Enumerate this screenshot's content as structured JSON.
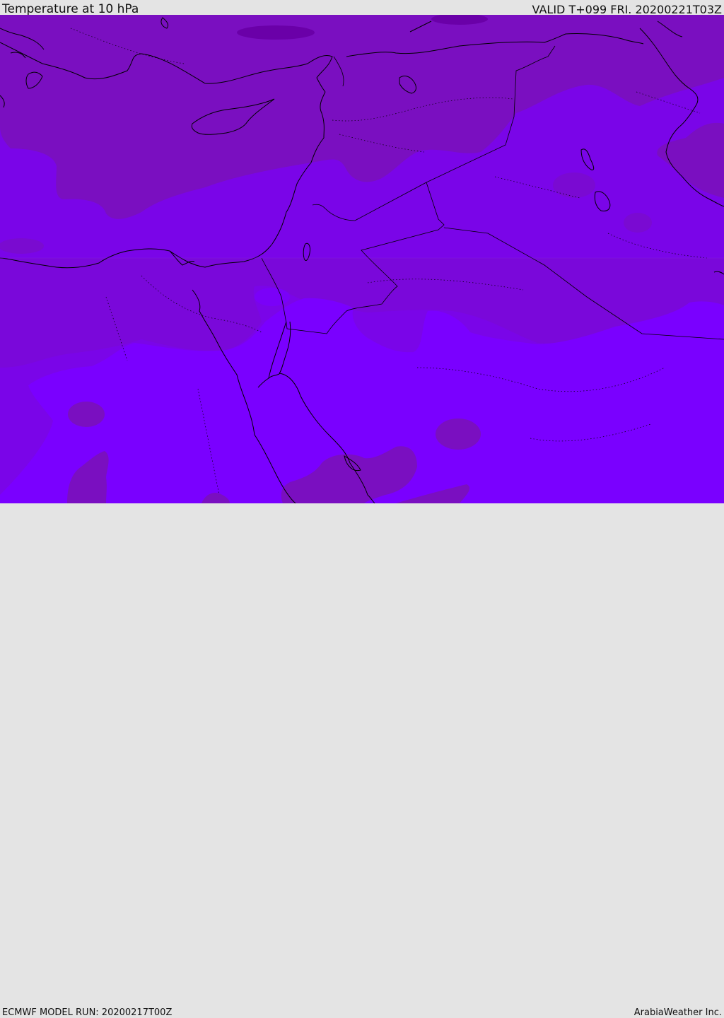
{
  "header": {
    "title": "Temperature at 10 hPa",
    "valid_time": "VALID T+099 FRI. 20200221T03Z"
  },
  "footer": {
    "model_run": "ECMWF MODEL RUN: 20200217T00Z",
    "credit": "ArabiaWeather Inc."
  },
  "map": {
    "region": "Eastern Mediterranean and Middle East",
    "colors": {
      "warm_band": "#7a0fc0",
      "mid_band": "#7a05e8",
      "cool_band": "#7a00ff",
      "dark_patch": "#6a00a8",
      "coastline": "#000000"
    }
  }
}
